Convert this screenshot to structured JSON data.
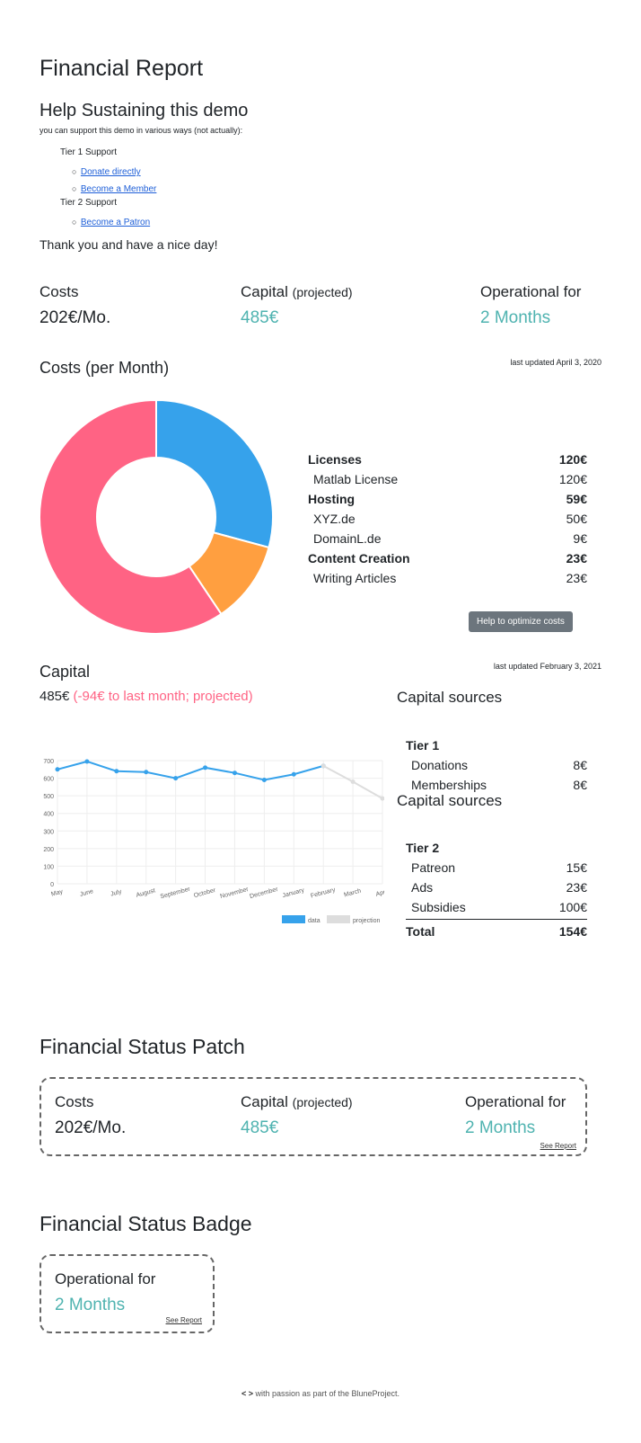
{
  "title": "Financial Report",
  "support": {
    "heading": "Help Sustaining this demo",
    "intro": "you can support this demo in various ways (not actually):",
    "tier1": {
      "label": "Tier 1 Support",
      "links": [
        "Donate directly",
        "Become a Member"
      ]
    },
    "tier2": {
      "label": "Tier 2 Support",
      "links": [
        "Become a Patron"
      ]
    },
    "thanks": "Thank you and have a nice day!"
  },
  "summary": {
    "costs_label": "Costs",
    "costs_value": "202€/Mo.",
    "capital_label": "Capital",
    "capital_sub": "(projected)",
    "capital_value": "485€",
    "operational_label": "Operational for",
    "operational_value": "2 Months"
  },
  "costs_section": {
    "heading": "Costs",
    "heading_sub": "(per Month)",
    "updated": "last updated April 3, 2020",
    "items": [
      {
        "name": "Licenses",
        "value": "120€",
        "bold": true
      },
      {
        "name": "Matlab License",
        "value": "120€",
        "bold": false
      },
      {
        "name": "Hosting",
        "value": "59€",
        "bold": true
      },
      {
        "name": "XYZ.de",
        "value": "50€",
        "bold": false
      },
      {
        "name": "DomainL.de",
        "value": "9€",
        "bold": false
      },
      {
        "name": "Content Creation",
        "value": "23€",
        "bold": true
      },
      {
        "name": "Writing Articles",
        "value": "23€",
        "bold": false
      }
    ],
    "button": "Help to optimize costs"
  },
  "capital_section": {
    "heading": "Capital",
    "value": "485€",
    "delta": "(-94€ to last month; projected)",
    "updated": "last updated February 3, 2021",
    "sources_heading": "Capital sources",
    "tier1": {
      "label": "Tier 1",
      "items": [
        {
          "name": "Donations",
          "value": "8€"
        },
        {
          "name": "Memberships",
          "value": "8€"
        }
      ]
    },
    "sources_heading_2": "Capital sources",
    "tier2": {
      "label": "Tier 2",
      "items": [
        {
          "name": "Patreon",
          "value": "15€"
        },
        {
          "name": "Ads",
          "value": "23€"
        },
        {
          "name": "Subsidies",
          "value": "100€"
        }
      ]
    },
    "total_label": "Total",
    "total_value": "154€"
  },
  "chart_data": [
    {
      "type": "pie",
      "categories": [
        "Licenses",
        "Hosting",
        "Content Creation"
      ],
      "values": [
        120,
        59,
        23
      ],
      "colors": [
        "#ff6384",
        "#36a2eb",
        "#ff9f40"
      ],
      "donut": true
    },
    {
      "type": "line",
      "categories": [
        "May",
        "June",
        "July",
        "August",
        "September",
        "October",
        "November",
        "December",
        "January",
        "February",
        "March",
        "April"
      ],
      "series": [
        {
          "name": "data",
          "color": "#36a2eb",
          "values": [
            650,
            695,
            640,
            635,
            600,
            660,
            630,
            590,
            622,
            670,
            null,
            null
          ]
        },
        {
          "name": "projection",
          "color": "#dddddd",
          "values": [
            null,
            null,
            null,
            null,
            null,
            null,
            null,
            null,
            null,
            670,
            580,
            485
          ]
        }
      ],
      "ylim": [
        0,
        700
      ],
      "yticks": [
        0,
        100,
        200,
        300,
        400,
        500,
        600,
        700
      ],
      "grid": true,
      "legend": "bottom-right"
    }
  ],
  "patch": {
    "heading": "Financial Status Patch",
    "costs_label": "Costs",
    "costs_value": "202€/Mo.",
    "capital_label": "Capital",
    "capital_sub": "(projected)",
    "capital_value": "485€",
    "operational_label": "Operational for",
    "operational_value": "2 Months",
    "see_report": "See Report"
  },
  "badge": {
    "heading": "Financial Status Badge",
    "operational_label": "Operational for",
    "operational_value": "2 Months",
    "see_report": "See Report"
  },
  "footer": {
    "code_glyph": "< >",
    "text": "with passion as part of the BluneProject."
  }
}
